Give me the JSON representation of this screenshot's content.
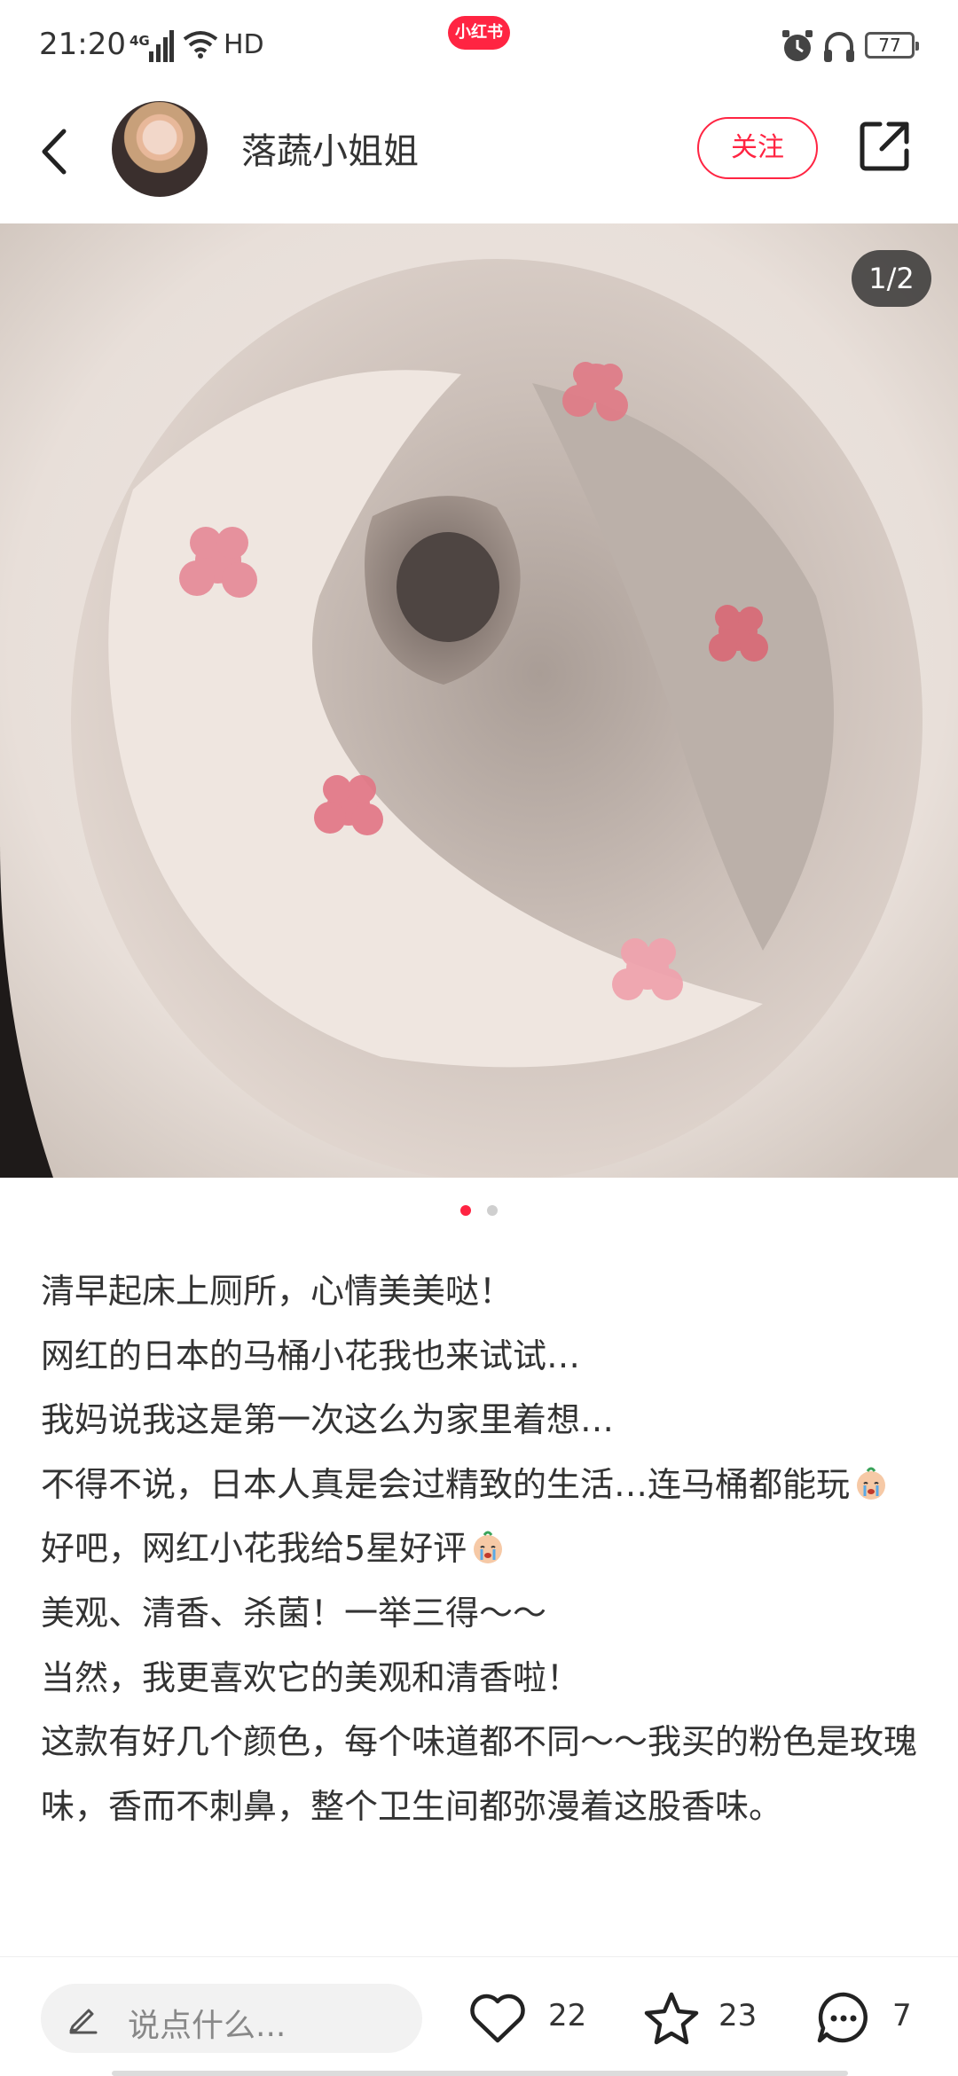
{
  "status_bar": {
    "time": "21:20",
    "network": "4G",
    "wifi_label": "HD",
    "app_badge": "小红书",
    "battery": "77"
  },
  "header": {
    "author_name": "落蔬小姐姐",
    "follow_label": "关注"
  },
  "photo": {
    "page_counter": "1/2",
    "page_total": 2,
    "page_current": 1
  },
  "post": {
    "lines": [
      "清早起床上厕所，心情美美哒！",
      "网红的日本的马桶小花我也来试试…",
      "我妈说我这是第一次这么为家里着想…",
      "不得不说，日本人真是会过精致的生活…连马桶都能玩",
      "好吧，网红小花我给5星好评",
      "美观、清香、杀菌！一举三得～～",
      "当然，我更喜欢它的美观和清香啦！",
      "这款有好几个颜色，每个味道都不同～～我买的粉色是玫瑰味，香而不刺鼻，整个卫生间都弥漫着这股香味。"
    ]
  },
  "bottom_bar": {
    "comment_placeholder": "说点什么...",
    "like_count": "22",
    "collect_count": "23",
    "comment_count": "7"
  },
  "colors": {
    "brand": "#ff2442",
    "text": "#333333"
  },
  "icons": [
    "back-arrow-icon",
    "share-icon",
    "pencil-icon",
    "heart-icon",
    "star-icon",
    "comment-bubble-icon",
    "alarm-icon",
    "headset-icon",
    "wifi-icon",
    "signal-icon"
  ]
}
